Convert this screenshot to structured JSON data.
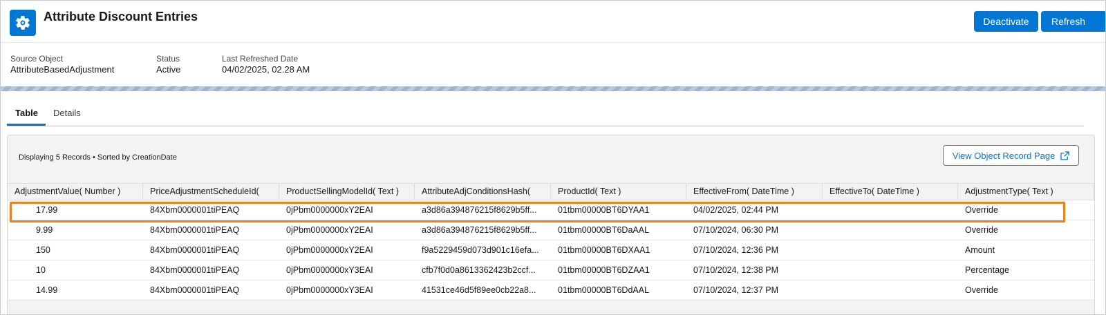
{
  "header": {
    "title": "Attribute Discount Entries",
    "buttons": {
      "deactivate": "Deactivate",
      "refresh": "Refresh"
    },
    "icon": "gear-icon",
    "fields": [
      {
        "label": "Source Object",
        "value": "AttributeBasedAdjustment"
      },
      {
        "label": "Status",
        "value": "Active"
      },
      {
        "label": "Last Refreshed Date",
        "value": "04/02/2025, 02.28 AM"
      }
    ]
  },
  "tabs": [
    {
      "label": "Table",
      "active": true
    },
    {
      "label": "Details",
      "active": false
    }
  ],
  "table_card": {
    "info": "Displaying 5 Records • Sorted by CreationDate",
    "view_button": "View Object Record Page",
    "columns": [
      "AdjustmentValue( Number )",
      "PriceAdjustmentScheduleId(",
      "ProductSellingModelId( Text )",
      "AttributeAdjConditionsHash(",
      "ProductId( Text )",
      "EffectiveFrom( DateTime )",
      "EffectiveTo( DateTime )",
      "AdjustmentType( Text )"
    ],
    "rows": [
      [
        "17.99",
        "84Xbm0000001tiPEAQ",
        "0jPbm0000000xY2EAI",
        "a3d86a394876215f8629b5ff...",
        "01tbm00000BT6DYAA1",
        "04/02/2025, 02:44 PM",
        "",
        "Override"
      ],
      [
        "9.99",
        "84Xbm0000001tiPEAQ",
        "0jPbm0000000xY2EAI",
        "a3d86a394876215f8629b5ff...",
        "01tbm00000BT6DaAAL",
        "07/10/2024, 06:30 PM",
        "",
        "Override"
      ],
      [
        "150",
        "84Xbm0000001tiPEAQ",
        "0jPbm0000000xY2EAI",
        "f9a5229459d073d901c16efa...",
        "01tbm00000BT6DXAA1",
        "07/10/2024, 12:36 PM",
        "",
        "Amount"
      ],
      [
        "10",
        "84Xbm0000001tiPEAQ",
        "0jPbm0000000xY3EAI",
        "cfb7f0d0a8613362423b2ccf...",
        "01tbm00000BT6DZAA1",
        "07/10/2024, 12:38 PM",
        "",
        "Percentage"
      ],
      [
        "14.99",
        "84Xbm0000001tiPEAQ",
        "0jPbm0000000xY3EAI",
        "41531ce46d5f89ee0cb22a8...",
        "01tbm00000BT6DdAAL",
        "07/10/2024, 12:37 PM",
        "",
        "Override"
      ]
    ],
    "highlighted_row": 0
  },
  "colors": {
    "brand": "#0176d3",
    "highlight": "#e0862a"
  }
}
